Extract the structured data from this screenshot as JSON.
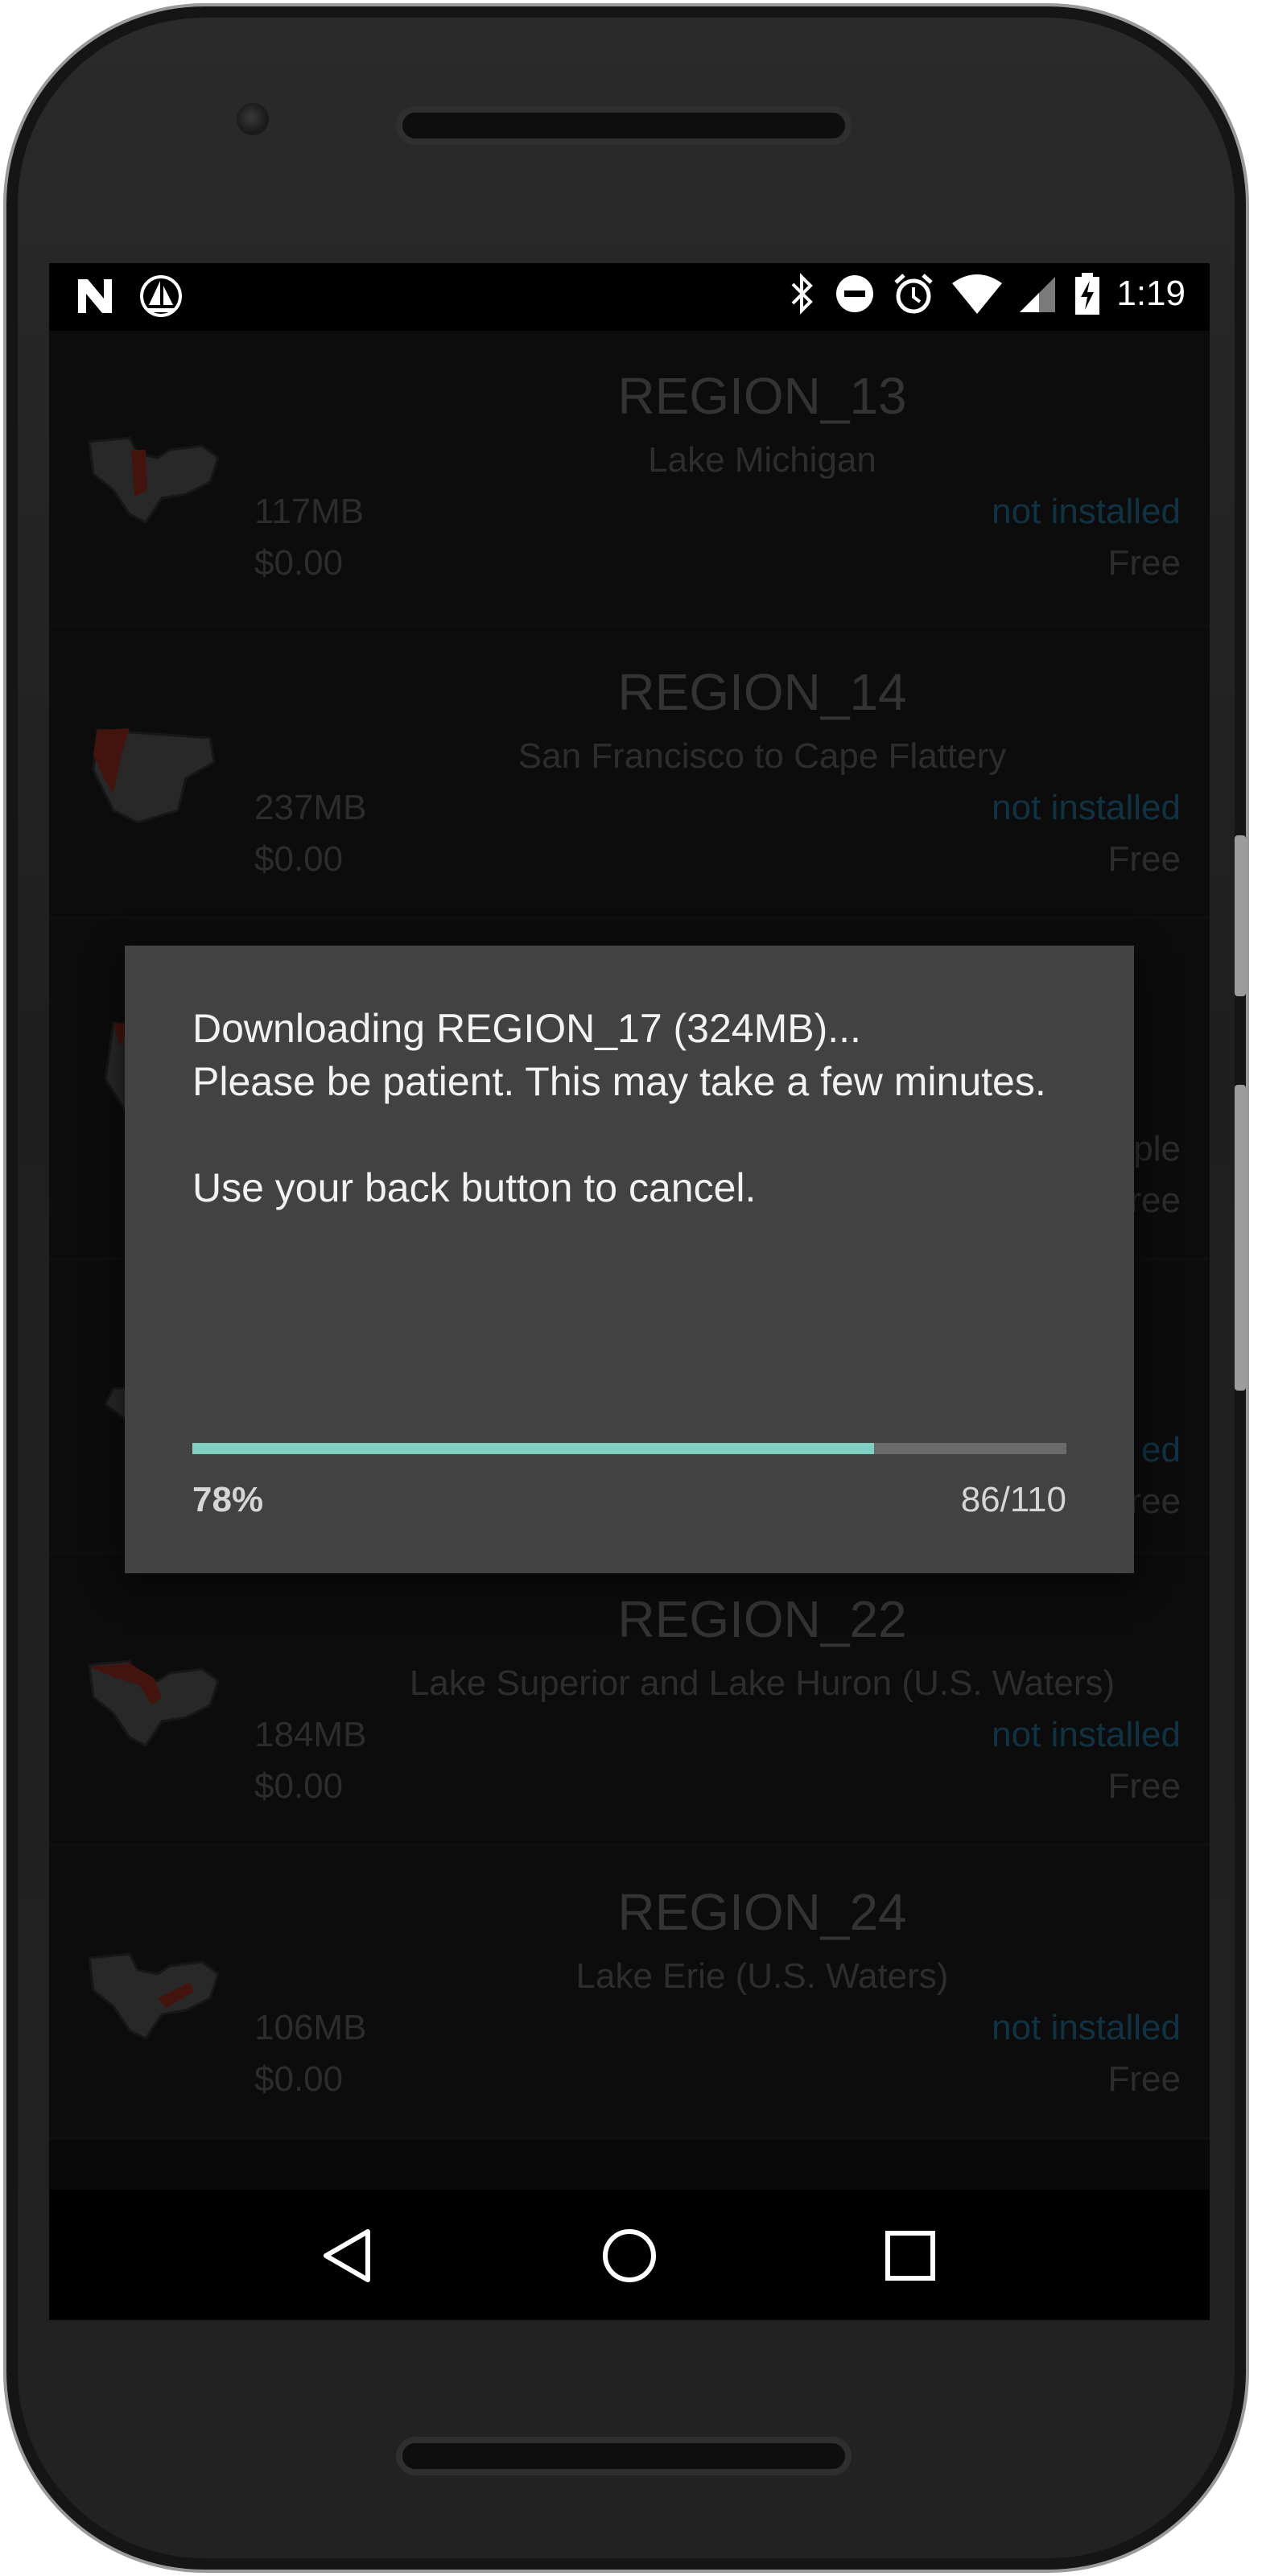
{
  "statusbar": {
    "time": "1:19",
    "left_icons": [
      "n-notification-icon",
      "sailboat-icon"
    ],
    "right_icons": [
      "bluetooth-icon",
      "do-not-disturb-icon",
      "alarm-icon",
      "wifi-icon",
      "cell-signal-icon",
      "battery-charging-icon"
    ]
  },
  "regions": [
    {
      "code": "REGION_13",
      "desc": "Lake Michigan",
      "size": "117MB",
      "price": "$0.00",
      "status": "not installed",
      "cost": "Free"
    },
    {
      "code": "REGION_14",
      "desc": "San Francisco to Cape Flattery",
      "size": "237MB",
      "price": "$0.00",
      "status": "not installed",
      "cost": "Free"
    },
    {
      "code": "",
      "desc": "",
      "size": "",
      "price": "",
      "status": "ple",
      "cost": "ree"
    },
    {
      "code": "",
      "desc": "",
      "size": "",
      "price": "",
      "status": "ed",
      "cost": "ree"
    },
    {
      "code": "REGION_22",
      "desc": "Lake Superior and Lake Huron (U.S. Waters)",
      "size": "184MB",
      "price": "$0.00",
      "status": "not installed",
      "cost": "Free"
    },
    {
      "code": "REGION_24",
      "desc": "Lake Erie (U.S. Waters)",
      "size": "106MB",
      "price": "$0.00",
      "status": "not installed",
      "cost": "Free"
    }
  ],
  "dialog": {
    "message": "Downloading REGION_17 (324MB)...\nPlease be patient. This may take a few minutes.\n\nUse your back button to cancel.",
    "percent_label": "78%",
    "count_label": "86/110",
    "progress_fraction": 0.78
  },
  "colors": {
    "accent": "#7fcfc2",
    "status_link": "#1f5b78",
    "map_highlight": "#8a2a1a"
  },
  "navbar": {
    "back_icon": "back-triangle-icon",
    "home_icon": "home-circle-icon",
    "recents_icon": "recents-square-icon"
  }
}
